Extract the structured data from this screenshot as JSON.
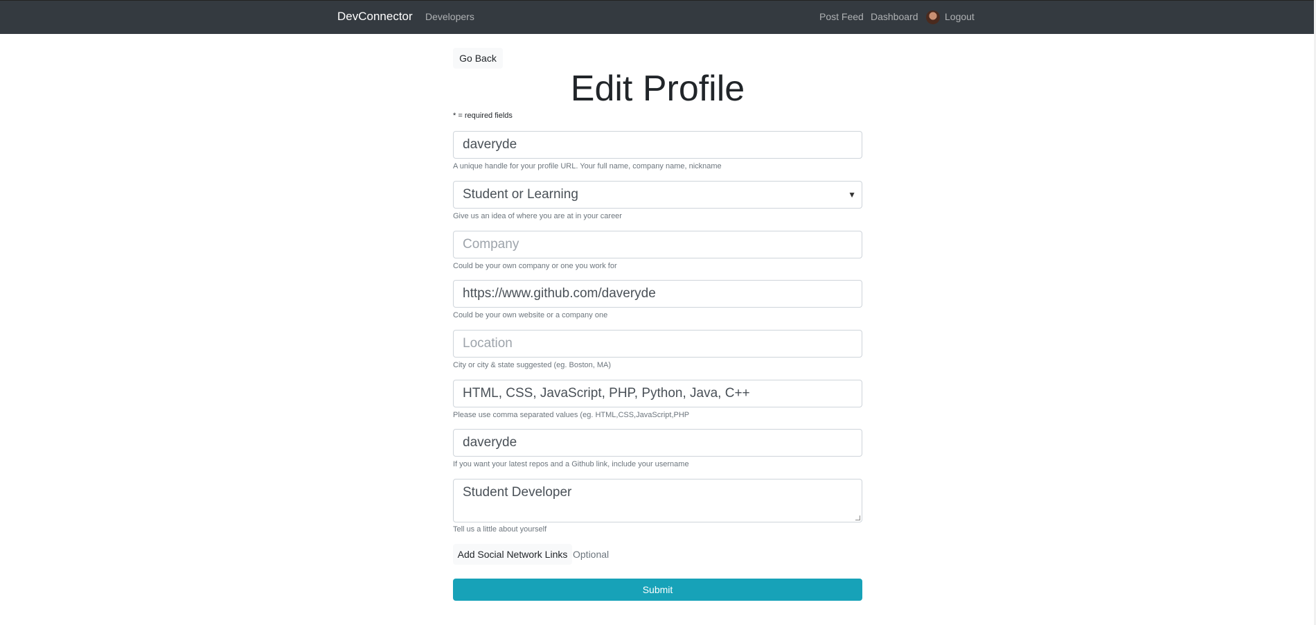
{
  "nav": {
    "brand": "DevConnector",
    "developers": "Developers",
    "post_feed": "Post Feed",
    "dashboard": "Dashboard",
    "logout": "Logout"
  },
  "go_back": "Go Back",
  "title": "Edit Profile",
  "required_note": "* = required fields",
  "fields": [
    {
      "value": "daveryde",
      "placeholder": "",
      "help": "A unique handle for your profile URL. Your full name, company name, nickname"
    },
    {
      "value": "Student or Learning",
      "placeholder": "",
      "help": "Give us an idea of where you are at in your career"
    },
    {
      "value": "",
      "placeholder": "Company",
      "help": "Could be your own company or one you work for"
    },
    {
      "value": "https://www.github.com/daveryde",
      "placeholder": "",
      "help": "Could be your own website or a company one"
    },
    {
      "value": "",
      "placeholder": "Location",
      "help": "City or city & state suggested (eg. Boston, MA)"
    },
    {
      "value": "HTML, CSS, JavaScript, PHP, Python, Java, C++",
      "placeholder": "",
      "help": "Please use comma separated values (eg. HTML,CSS,JavaScript,PHP"
    },
    {
      "value": "daveryde",
      "placeholder": "",
      "help": "If you want your latest repos and a Github link, include your username"
    },
    {
      "value": "Student Developer",
      "placeholder": "",
      "help": "Tell us a little about yourself"
    }
  ],
  "social_button": "Add Social Network Links",
  "optional": "Optional",
  "submit": "Submit",
  "colors": {
    "navbar": "#343a40",
    "submit": "#17a2b8"
  }
}
